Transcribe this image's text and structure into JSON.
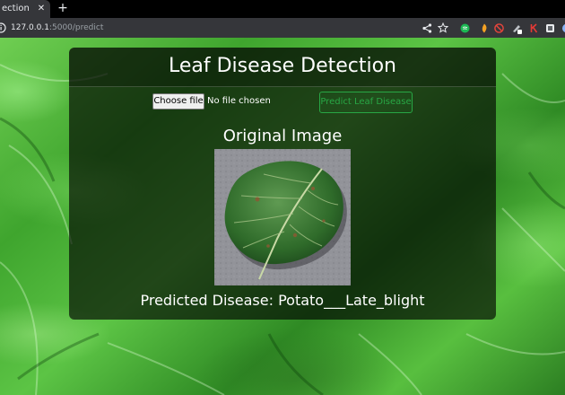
{
  "browser": {
    "tab_title": "ection",
    "url_host": "127.0.0.1",
    "url_rest": ":5000/predict",
    "icons": [
      "info-icon",
      "share-icon",
      "star-icon",
      "extension-green-icon",
      "extension-orange-icon",
      "extension-red-icon",
      "extension-pen-icon",
      "extension-red-k-icon",
      "extension-square-icon"
    ]
  },
  "page": {
    "title": "Leaf Disease Detection",
    "file_input": {
      "button_label": "Choose file",
      "status": "No file chosen"
    },
    "predict_button_label": "Predict Leaf Disease",
    "original_image_heading": "Original Image",
    "result_text": "Predicted Disease: Potato___Late_blight"
  },
  "colors": {
    "accent_green": "#28a745",
    "card_bg": "rgba(0,0,0,0.64)",
    "text": "#ffffff"
  }
}
